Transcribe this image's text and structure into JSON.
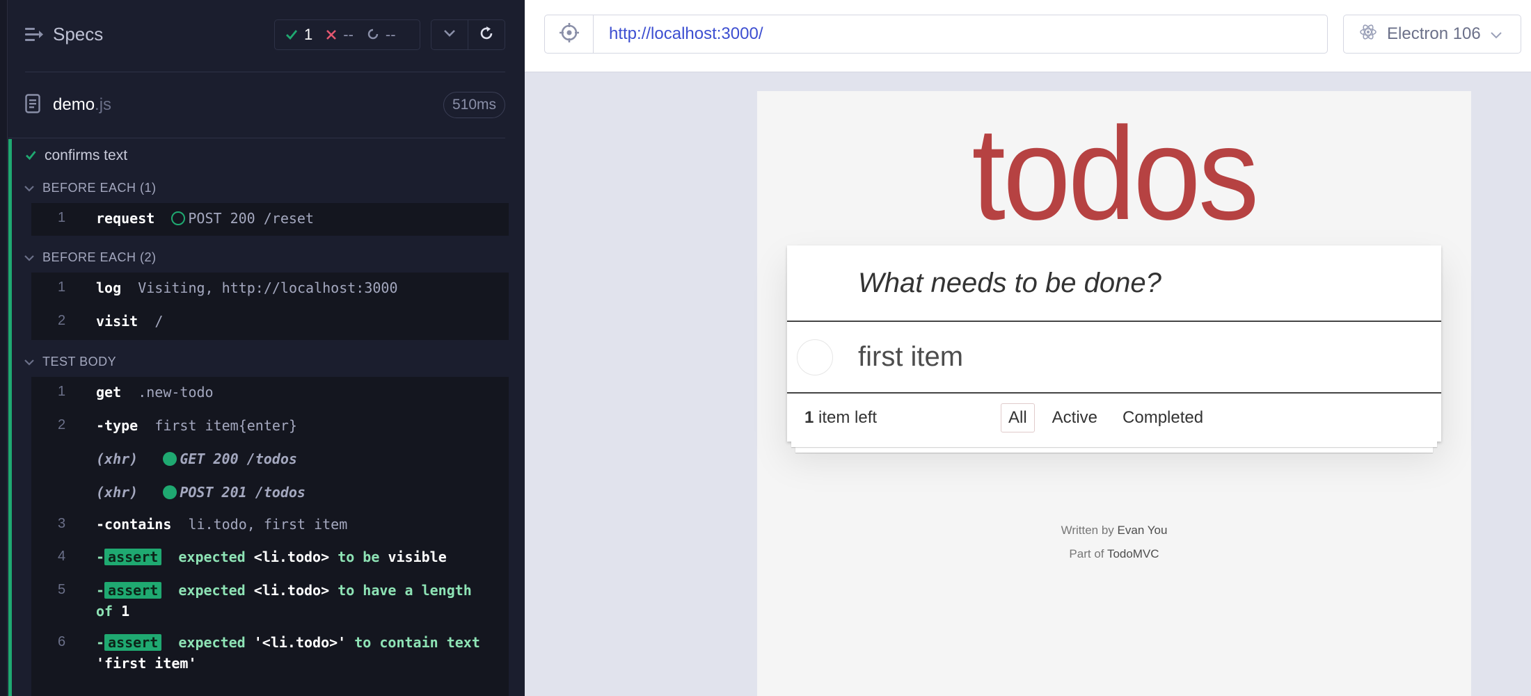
{
  "reporter": {
    "specs_label": "Specs",
    "stats": {
      "passed": "1",
      "failed": "--",
      "pending": "--"
    },
    "file": {
      "name": "demo",
      "ext": ".js",
      "duration": "510ms"
    },
    "test": {
      "title": "confirms text",
      "hook1": {
        "label": "BEFORE EACH (1)",
        "cmds": [
          {
            "n": "1",
            "name": "request",
            "msg": "POST 200 /reset"
          }
        ]
      },
      "hook2": {
        "label": "BEFORE EACH (2)",
        "cmds": [
          {
            "n": "1",
            "name": "log",
            "msg": "Visiting, http://localhost:3000"
          },
          {
            "n": "2",
            "name": "visit",
            "msg": "/"
          }
        ]
      },
      "body": {
        "label": "TEST BODY",
        "c1": {
          "n": "1",
          "name": "get",
          "msg": ".new-todo"
        },
        "c2": {
          "n": "2",
          "name": "-type",
          "msg": "first item{enter}"
        },
        "xhr1": {
          "tag": "(xhr)",
          "msg": "GET 200 /todos"
        },
        "xhr2": {
          "tag": "(xhr)",
          "msg": "POST 201 /todos"
        },
        "c3": {
          "n": "3",
          "name": "-contains",
          "msg": "li.todo, first item"
        },
        "c4": {
          "n": "4",
          "dash": "-",
          "badge": "assert",
          "p1": "expected",
          "p2": "<li.todo>",
          "p3": "to be",
          "p4": "visible"
        },
        "c5": {
          "n": "5",
          "dash": "-",
          "badge": "assert",
          "p1": "expected",
          "p2": "<li.todo>",
          "p3": "to have a length",
          "line2": "of",
          "p4": "1"
        },
        "c6": {
          "n": "6",
          "dash": "-",
          "badge": "assert",
          "p1": "expected",
          "p2": "'<li.todo>'",
          "p3": "to contain text",
          "line2": "'first item'"
        }
      }
    }
  },
  "aut": {
    "url": "http://localhost:3000/",
    "browser": "Electron 106",
    "app": {
      "title": "todos",
      "new_todo_placeholder": "What needs to be done?",
      "items": [
        {
          "label": "first item",
          "completed": false
        }
      ],
      "count_num": "1",
      "count_text": "item left",
      "filters": {
        "all": "All",
        "active": "Active",
        "completed": "Completed"
      },
      "info": {
        "written_prefix": "Written by",
        "author": "Evan You",
        "part_prefix": "Part of",
        "project": "TodoMVC"
      }
    }
  },
  "colors": {
    "pass": "#1fa971",
    "fail": "#e45770",
    "link": "#3d4fd1",
    "todos_title": "#af2f2f"
  }
}
